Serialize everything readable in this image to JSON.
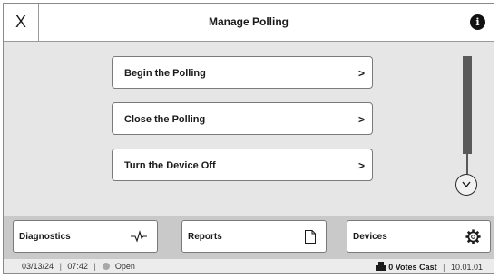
{
  "header": {
    "close_label": "X",
    "title": "Manage Polling",
    "info_label": "i"
  },
  "menu": {
    "items": [
      {
        "label": "Begin the Polling",
        "chevron": ">"
      },
      {
        "label": "Close the Polling",
        "chevron": ">"
      },
      {
        "label": "Turn the Device Off",
        "chevron": ">"
      }
    ]
  },
  "toolbar": {
    "diagnostics_label": "Diagnostics",
    "reports_label": "Reports",
    "devices_label": "Devices"
  },
  "status": {
    "date": "03/13/24",
    "time": "07:42",
    "polls_state": "Open",
    "votes_cast": "0 Votes Cast",
    "version": "10.01.01",
    "sep": "|"
  }
}
